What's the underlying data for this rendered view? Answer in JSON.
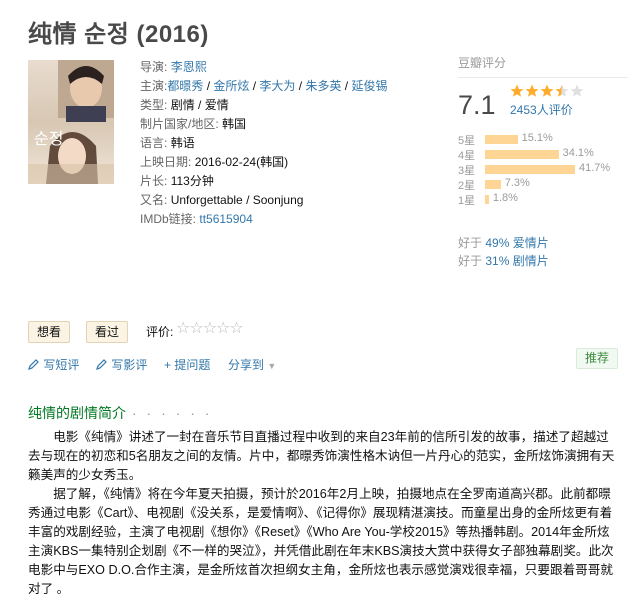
{
  "title": "纯情 순정 (2016)",
  "poster": {
    "overlay_text": "순정"
  },
  "info": [
    {
      "label": "导演:",
      "links": [
        "李恩熙"
      ]
    },
    {
      "label": "主演:",
      "links": [
        "都暻秀",
        "金所炫",
        "李大为",
        "朱多英",
        "延俊锡"
      ]
    },
    {
      "label": "类型:",
      "value": "剧情 / 爱情"
    },
    {
      "label": "制片国家/地区:",
      "value": "韩国"
    },
    {
      "label": "语言:",
      "value": "韩语"
    },
    {
      "label": "上映日期:",
      "value": "2016-02-24(韩国)"
    },
    {
      "label": "片长:",
      "value": "113分钟"
    },
    {
      "label": "又名:",
      "value": "Unforgettable / Soonjung"
    },
    {
      "label": "IMDb链接:",
      "links": [
        "tt5615904"
      ]
    }
  ],
  "rating": {
    "header": "豆瓣评分",
    "score": "7.1",
    "stars_value": 3.5,
    "votes_text": "2453人评价",
    "distribution": [
      {
        "label": "5星",
        "pct": "15.1%",
        "value": 15.1
      },
      {
        "label": "4星",
        "pct": "34.1%",
        "value": 34.1
      },
      {
        "label": "3星",
        "pct": "41.7%",
        "value": 41.7
      },
      {
        "label": "2星",
        "pct": "7.3%",
        "value": 7.3
      },
      {
        "label": "1星",
        "pct": "1.8%",
        "value": 1.8
      }
    ],
    "better_than": [
      {
        "prefix": "好于 ",
        "pct": "49%",
        "genre": "爱情片"
      },
      {
        "prefix": "好于 ",
        "pct": "31%",
        "genre": "剧情片"
      }
    ]
  },
  "buttons": {
    "want": "想看",
    "seen": "看过",
    "rate_label": "评价:",
    "empty_stars": "☆☆☆☆☆"
  },
  "actions": [
    {
      "icon": "pencil-icon",
      "label": "写短评"
    },
    {
      "icon": "pencil-icon",
      "label": "写影评"
    },
    {
      "icon": "plus-icon",
      "label": "提问题"
    },
    {
      "icon": "",
      "label": "分享到"
    }
  ],
  "recommend": "推荐",
  "summary": {
    "title": "纯情的剧情简介",
    "dots": "· · · · · ·",
    "paragraphs": [
      "电影《纯情》讲述了一封在音乐节目直播过程中收到的来自23年前的信所引发的故事，描述了超越过去与现在的初恋和5名朋友之间的友情。片中，都暻秀饰演性格木讷但一片丹心的范实，金所炫饰演拥有天籁美声的少女秀玉。",
      "据了解，《纯情》将在今年夏天拍摄，预计於2016年2月上映，拍摄地点在全罗南道高兴郡。此前都暻秀通过电影《Cart》、电视剧《没关系，是爱情啊》、《记得你》展现精湛演技。而童星出身的金所炫更有着丰富的戏剧经验，主演了电视剧《想你》《Reset》《Who Are You-学校2015》等热播韩剧。2014年金所炫主演KBS一集特别企划剧《不一样的哭泣》，并凭借此剧在年末KBS演技大赏中获得女子部独幕剧奖。此次电影中与EXO D.O.合作主演，是金所炫首次担纲女主角，金所炫也表示感觉演戏很幸福，只要跟着哥哥就对了 。"
    ]
  }
}
